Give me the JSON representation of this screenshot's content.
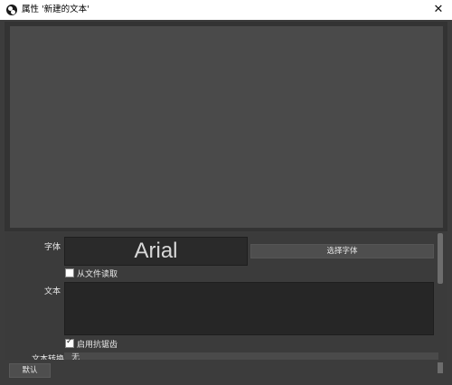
{
  "window": {
    "title": "属性 '新建的文本'",
    "close_glyph": "✕"
  },
  "properties": {
    "font_label": "字体",
    "font_preview": "Arial",
    "choose_font_button": "选择字体",
    "read_from_file_label": "从文件读取",
    "read_from_file_checked": false,
    "text_label": "文本",
    "text_value": "",
    "antialias_label": "启用抗锯齿",
    "antialias_checked": true,
    "transform_label": "文本转换",
    "transform_value": "无"
  },
  "footer": {
    "defaults_button": "默认"
  }
}
